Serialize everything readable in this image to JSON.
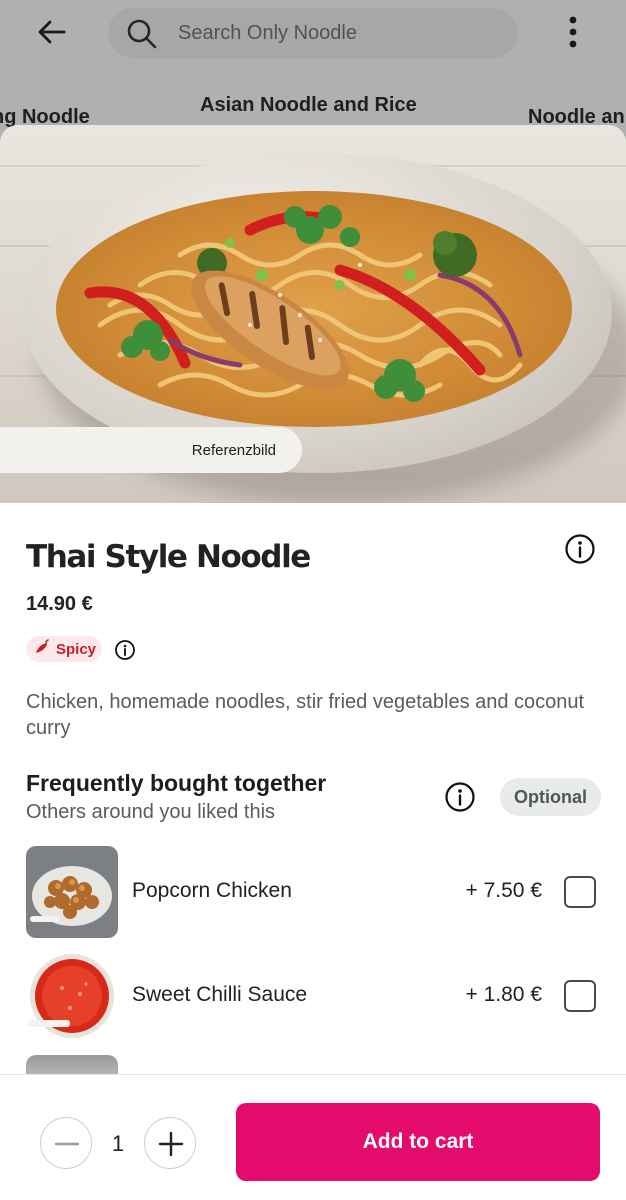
{
  "background": {
    "search_placeholder": "Search Only Noodle",
    "categories": [
      "ng Noodle",
      "Asian Noodle and Rice",
      "Noodle an"
    ]
  },
  "hero": {
    "reference_label": "Referenzbild"
  },
  "product": {
    "name": "Thai Style Noodle",
    "price": "14.90 €",
    "badge": "Spicy",
    "description": "Chicken, homemade noodles, stir fried vegetables and coconut curry"
  },
  "frequently_bought": {
    "title": "Frequently bought together",
    "subtitle": "Others around you liked this",
    "tag": "Optional",
    "items": [
      {
        "name": "Popcorn Chicken",
        "price": "+ 7.50 €",
        "checked": false
      },
      {
        "name": "Sweet Chilli Sauce",
        "price": "+ 1.80 €",
        "checked": false
      }
    ]
  },
  "cart": {
    "quantity": "1",
    "button_label": "Add to cart"
  },
  "colors": {
    "accent": "#e50b6d",
    "spicy_text": "#c81e2e",
    "spicy_bg": "#fde8ea"
  }
}
